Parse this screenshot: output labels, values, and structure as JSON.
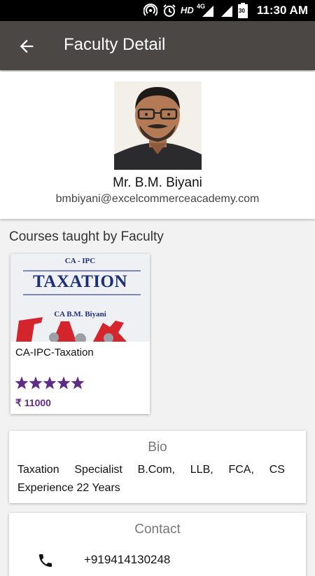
{
  "status_bar": {
    "hd_label": "HD",
    "network_label": "4G",
    "battery_level": "30",
    "time": "11:30 AM",
    "icons": [
      "hotspot-icon",
      "alarm-icon",
      "signal-icon",
      "signal-icon",
      "battery-icon"
    ]
  },
  "app_bar": {
    "title": "Faculty Detail",
    "back_icon": "arrow-back-icon"
  },
  "faculty": {
    "name": "Mr. B.M. Biyani",
    "email": "bmbiyani@excelcommerceacademy.com"
  },
  "courses_section": {
    "title": "Courses taught by Faculty",
    "courses": [
      {
        "cover_header": "CA - IPC",
        "cover_title": "TAXATION",
        "cover_author": "CA B.M. Biyani",
        "name": "CA-IPC-Taxation",
        "rating": 5,
        "rating_max": 5,
        "price": "₹ 11000"
      }
    ]
  },
  "bio": {
    "heading": "Bio",
    "line1": [
      "Taxation",
      "Specialist",
      "B.Com,",
      "LLB,",
      "FCA,",
      "CS"
    ],
    "line2": "Experience 22 Years"
  },
  "contact": {
    "heading": "Contact",
    "phone": "+919414130248",
    "phone_icon": "phone-icon"
  },
  "colors": {
    "app_bar": "#4a4744",
    "accent_purple": "#5e2b86",
    "star": "#5e2b86",
    "status_bar": "#000000"
  }
}
